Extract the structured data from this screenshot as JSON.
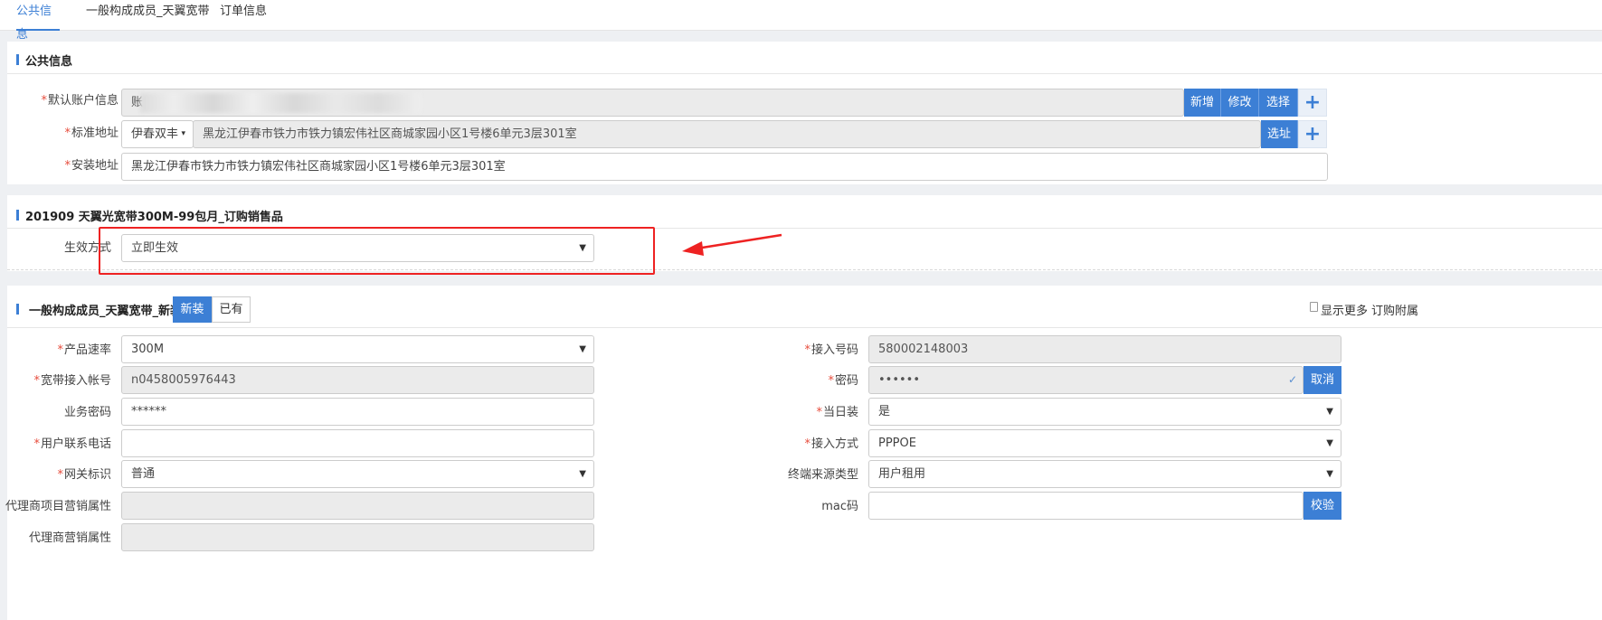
{
  "tabs": [
    "公共信息",
    "一般构成成员_天翼宽带",
    "订单信息"
  ],
  "public_info": {
    "title": "公共信息",
    "default_account": {
      "label": "默认账户信息",
      "value": "账",
      "partial_visible": "...513400387",
      "buttons": [
        "新增",
        "修改",
        "选择"
      ],
      "plus": "+"
    },
    "standard_address": {
      "label": "标准地址",
      "area": "伊春双丰",
      "value": "黑龙江伊春市铁力市铁力镇宏伟社区商城家园小区1号楼6单元3层301室",
      "button": "选址",
      "plus": "+"
    },
    "install_address": {
      "label": "安装地址",
      "value": "黑龙江伊春市铁力市铁力镇宏伟社区商城家园小区1号楼6单元3层301室"
    }
  },
  "offer": {
    "title": "201909 天翼光宽带300M-99包月_订购销售品",
    "effective_mode": {
      "label": "生效方式",
      "value": "立即生效"
    }
  },
  "member": {
    "title": "一般构成成员_天翼宽带_新装",
    "toggle": [
      "新装",
      "已有"
    ],
    "links": [
      "显示更多",
      "订购附属"
    ],
    "left_fields": [
      {
        "label": "产品速率",
        "required": true,
        "value": "300M",
        "type": "select"
      },
      {
        "label": "宽带接入帐号",
        "required": true,
        "value": "n0458005976443",
        "type": "disabled"
      },
      {
        "label": "业务密码",
        "required": false,
        "value": "******",
        "type": "text"
      },
      {
        "label": "用户联系电话",
        "required": true,
        "value": "",
        "type": "text"
      },
      {
        "label": "网关标识",
        "required": true,
        "value": "普通",
        "type": "select"
      },
      {
        "label": "代理商项目营销属性",
        "required": false,
        "value": "",
        "type": "disabled"
      },
      {
        "label": "代理商营销属性",
        "required": false,
        "value": "",
        "type": "disabled"
      }
    ],
    "right_fields": [
      {
        "label": "接入号码",
        "required": true,
        "value": "580002148003",
        "type": "disabled"
      },
      {
        "label": "密码",
        "required": true,
        "value": "••••••",
        "type": "password",
        "button": "取消"
      },
      {
        "label": "当日装",
        "required": true,
        "value": "是",
        "type": "select"
      },
      {
        "label": "接入方式",
        "required": true,
        "value": "PPPOE",
        "type": "select"
      },
      {
        "label": "终端来源类型",
        "required": false,
        "value": "用户租用",
        "type": "select"
      },
      {
        "label": "mac码",
        "required": false,
        "value": "",
        "type": "text",
        "button": "校验"
      }
    ]
  },
  "colors": {
    "accent": "#3c7fd5",
    "required": "#e74c3c",
    "annotation": "#ee2222"
  }
}
